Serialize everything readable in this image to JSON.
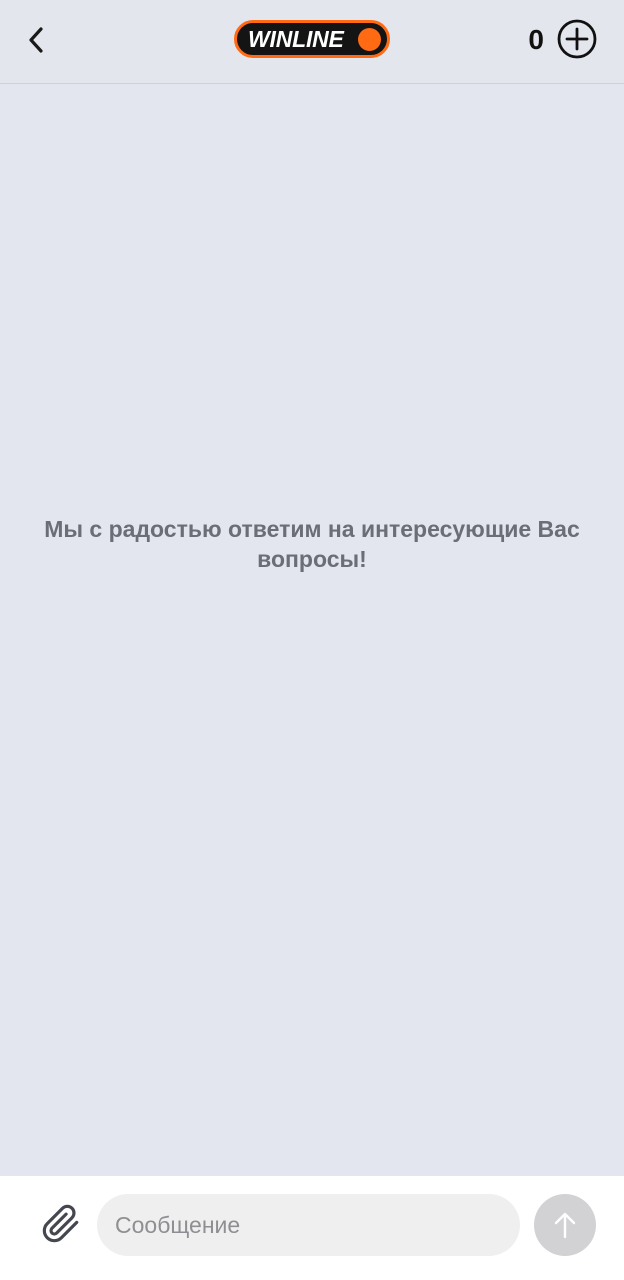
{
  "header": {
    "logo_text": "WINLINE",
    "counter": "0",
    "icons": {
      "back": "chevron-left-icon",
      "add": "plus-circle-icon"
    }
  },
  "chat": {
    "welcome_message": "Мы с радостью ответим на интересующие Вас вопросы!"
  },
  "composer": {
    "placeholder": "Сообщение",
    "value": "",
    "icons": {
      "attach": "paperclip-icon",
      "send": "arrow-up-icon"
    }
  },
  "colors": {
    "brand_orange": "#ff6a13",
    "logo_background": "#141414",
    "chat_background": "#e3e6ee",
    "send_button_disabled": "#d2d2d5"
  }
}
